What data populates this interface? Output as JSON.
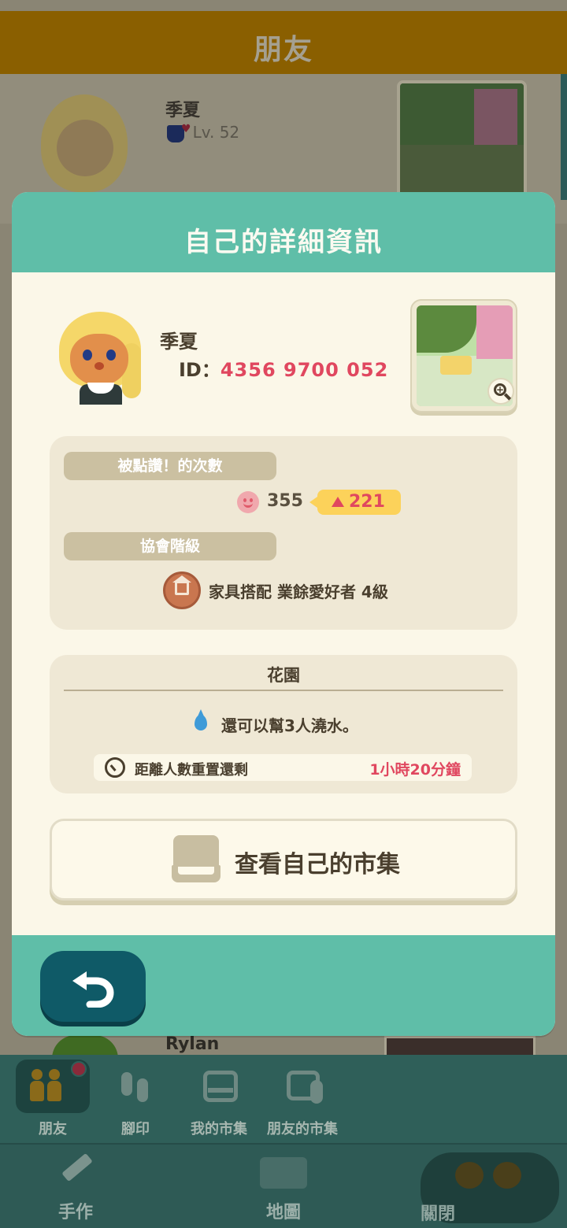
{
  "background": {
    "header_title": "朋友",
    "friend": {
      "name": "季夏",
      "level": "Lv. 52"
    },
    "next_friend_name": "Rylan"
  },
  "tabs": [
    {
      "label": "朋友",
      "icon": "friends-icon",
      "active": true,
      "has_notification": true
    },
    {
      "label": "腳印",
      "icon": "footprints-icon"
    },
    {
      "label": "我的市集",
      "icon": "market-stall-icon"
    },
    {
      "label": "朋友的市集",
      "icon": "friends-market-icon"
    }
  ],
  "bottom_bar": {
    "craft_label": "手作",
    "map_label": "地圖",
    "close_label": "關閉"
  },
  "modal": {
    "title": "自己的詳細資訊",
    "profile": {
      "name": "季夏",
      "id_label": "ID：",
      "id_value": "4356 9700 052"
    },
    "likes": {
      "label": "被點讚！的次數",
      "count": "355",
      "increase": "221"
    },
    "association": {
      "label": "協會階級",
      "rank": "家具搭配 業餘愛好者 4級"
    },
    "garden": {
      "title": "花園",
      "water_text": "還可以幫3人澆水。",
      "reset_label": "距離人數重置還剩",
      "reset_value": "1小時20分鐘"
    },
    "market_button_label": "查看自己的市集"
  },
  "colors": {
    "accent_teal": "#5fbea8",
    "highlight_red": "#e0475f",
    "badge_yellow": "#fcd25a",
    "back_button": "#0f5a67"
  }
}
